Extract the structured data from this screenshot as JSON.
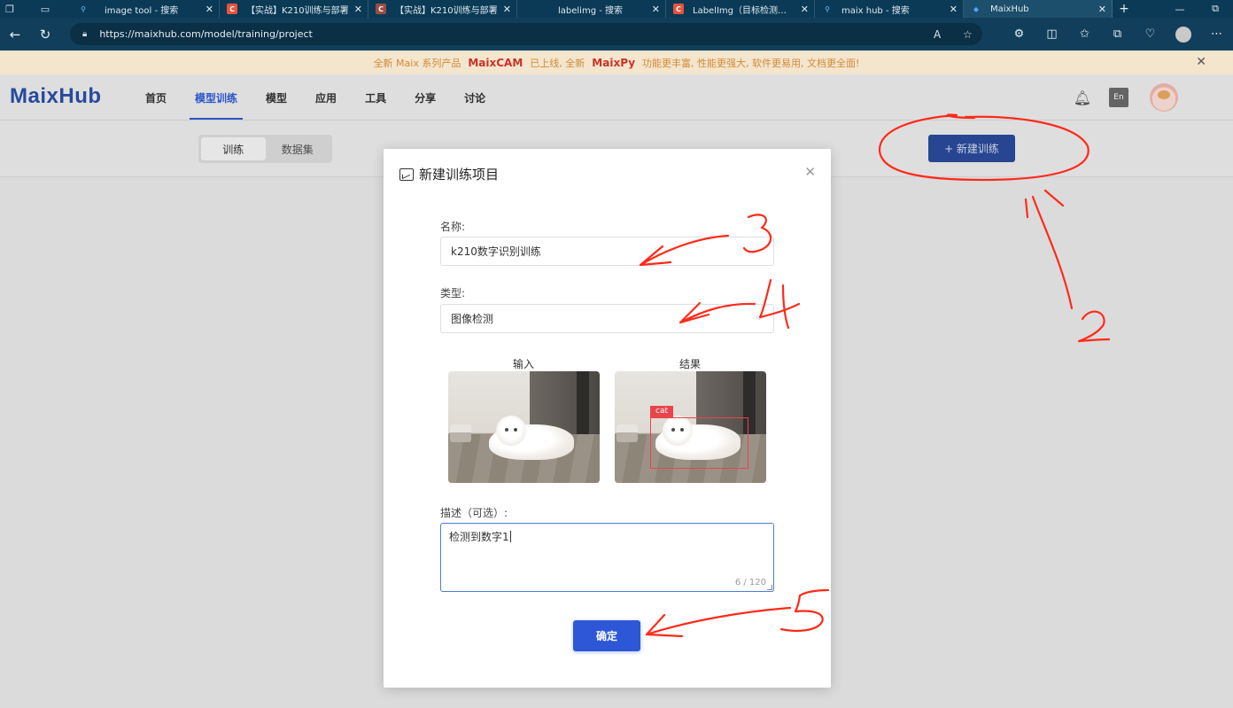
{
  "browser": {
    "tabs": [
      {
        "title": "image tool - 搜索",
        "icon": "search-icon",
        "active": false
      },
      {
        "title": "【实战】K210训练与部署",
        "icon": "csdn-icon",
        "active": false
      },
      {
        "title": "【实战】K210训练与部署",
        "icon": "csdn-icon",
        "active": false
      },
      {
        "title": "labelimg - 搜索",
        "icon": "search-icon",
        "active": false
      },
      {
        "title": "LabelImg（目标检测标注",
        "icon": "csdn-icon",
        "active": false
      },
      {
        "title": "maix hub - 搜索",
        "icon": "search-icon",
        "active": false
      },
      {
        "title": "MaixHub",
        "icon": "maixhub-icon",
        "active": true
      }
    ],
    "url": "https://maixhub.com/model/training/project"
  },
  "announcement": {
    "part1": "全新 Maix 系列产品",
    "product1": "MaixCAM",
    "part2": "已上线, 全新",
    "product2": "MaixPy",
    "part3": "功能更丰富, 性能更强大, 软件更易用, 文档更全面!"
  },
  "header": {
    "logo": "MaixHub",
    "nav": [
      "首页",
      "模型训练",
      "模型",
      "应用",
      "工具",
      "分享",
      "讨论"
    ],
    "active_nav": "模型训练",
    "lang_label": "En"
  },
  "subheader": {
    "segments": [
      "训练",
      "数据集"
    ],
    "active_segment": "训练",
    "new_button": "+ 新建训练"
  },
  "modal": {
    "title": "新建训练项目",
    "name_label": "名称:",
    "name_value": "k210数字识别训练",
    "type_label": "类型:",
    "type_value": "图像检测",
    "input_caption": "输入",
    "result_caption": "结果",
    "detection_label": "cat",
    "desc_label": "描述（可选）:",
    "desc_value": "检测到数字1",
    "desc_count": "6 / 120",
    "confirm": "确定"
  },
  "annotations": {
    "color": "#ff2a1a",
    "numbers": [
      "2",
      "3",
      "4",
      "5"
    ]
  }
}
